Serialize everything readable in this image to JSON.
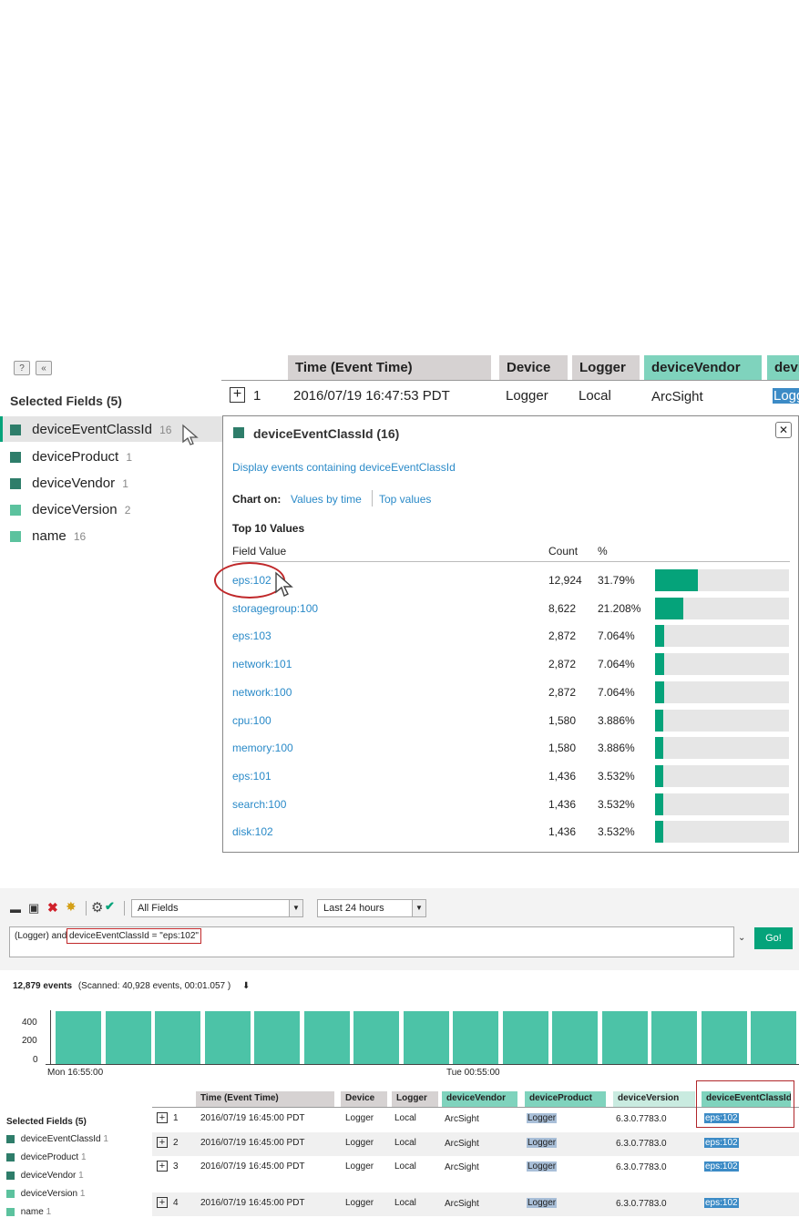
{
  "top": {
    "help_label": "?",
    "collapse_label": "«",
    "selected_fields_title": "Selected Fields (5)",
    "fields": [
      {
        "name": "deviceEventClassId",
        "count": "16",
        "color": "#2e7d6a"
      },
      {
        "name": "deviceProduct",
        "count": "1",
        "color": "#2e7d6a"
      },
      {
        "name": "deviceVendor",
        "count": "1",
        "color": "#2e7d6a"
      },
      {
        "name": "deviceVersion",
        "count": "2",
        "color": "#5cc29e"
      },
      {
        "name": "name",
        "count": "16",
        "color": "#5cc29e"
      }
    ],
    "columns": [
      "Time (Event Time)",
      "Device",
      "Logger",
      "deviceVendor",
      "devi"
    ],
    "row": {
      "index": "1",
      "time": "2016/07/19 16:47:53 PDT",
      "device": "Logger",
      "logger": "Local",
      "vendor": "ArcSight",
      "product": "Logg"
    },
    "popup": {
      "title": "deviceEventClassId (16)",
      "close_label": "✕",
      "display_link": "Display events containing deviceEventClassId",
      "chart_on_label": "Chart on:",
      "values_by_time": "Values by time",
      "top_values": "Top values",
      "top10_title": "Top 10 Values",
      "col_field_value": "Field Value",
      "col_count": "Count",
      "col_pct": "%",
      "rows": [
        {
          "value": "eps:102",
          "count": "12,924",
          "pct": "31.79%",
          "frac": 0.3179
        },
        {
          "value": "storagegroup:100",
          "count": "8,622",
          "pct": "21.208%",
          "frac": 0.21208
        },
        {
          "value": "eps:103",
          "count": "2,872",
          "pct": "7.064%",
          "frac": 0.07064
        },
        {
          "value": "network:101",
          "count": "2,872",
          "pct": "7.064%",
          "frac": 0.07064
        },
        {
          "value": "network:100",
          "count": "2,872",
          "pct": "7.064%",
          "frac": 0.07064
        },
        {
          "value": "cpu:100",
          "count": "1,580",
          "pct": "3.886%",
          "frac": 0.03886
        },
        {
          "value": "memory:100",
          "count": "1,580",
          "pct": "3.886%",
          "frac": 0.03886
        },
        {
          "value": "eps:101",
          "count": "1,436",
          "pct": "3.532%",
          "frac": 0.03532
        },
        {
          "value": "search:100",
          "count": "1,436",
          "pct": "3.532%",
          "frac": 0.03532
        },
        {
          "value": "disk:102",
          "count": "1,436",
          "pct": "3.532%",
          "frac": 0.03532
        }
      ]
    }
  },
  "bottom": {
    "toolbar": {
      "field_select": "All Fields",
      "time_select": "Last 24 hours",
      "query_prefix": "(Logger) and ",
      "query_highlight": "deviceEventClassId = \"eps:102\"",
      "go_label": "Go!"
    },
    "summary": {
      "events": "12,879 events",
      "scanned": "(Scanned: 40,928 events,  00:01.057 )"
    },
    "histogram": {
      "y_ticks": [
        "400",
        "200",
        "0"
      ],
      "x_labels": [
        "Mon 16:55:00",
        "Tue 00:55:00"
      ],
      "bar_frac": [
        0.97,
        0.97,
        0.97,
        0.97,
        0.97,
        0.97,
        0.97,
        0.97,
        0.97,
        0.97,
        0.97,
        0.97,
        0.97,
        0.97,
        0.97
      ]
    },
    "selected_fields_title": "Selected Fields (5)",
    "fields": [
      {
        "name": "deviceEventClassId",
        "count": "1",
        "color": "#2e7d6a"
      },
      {
        "name": "deviceProduct",
        "count": "1",
        "color": "#2e7d6a"
      },
      {
        "name": "deviceVendor",
        "count": "1",
        "color": "#2e7d6a"
      },
      {
        "name": "deviceVersion",
        "count": "1",
        "color": "#5cc29e"
      },
      {
        "name": "name",
        "count": "1",
        "color": "#5cc29e"
      }
    ],
    "columns": [
      "Time (Event Time)",
      "Device",
      "Logger",
      "deviceVendor",
      "deviceProduct",
      "deviceVersion",
      "deviceEventClassId"
    ],
    "rows": [
      {
        "index": "1",
        "time": "2016/07/19 16:45:00 PDT",
        "device": "Logger",
        "logger": "Local",
        "vendor": "ArcSight",
        "product": "Logger",
        "version": "6.3.0.7783.0",
        "classid": "eps:102"
      },
      {
        "index": "2",
        "time": "2016/07/19 16:45:00 PDT",
        "device": "Logger",
        "logger": "Local",
        "vendor": "ArcSight",
        "product": "Logger",
        "version": "6.3.0.7783.0",
        "classid": "eps:102"
      },
      {
        "index": "3",
        "time": "2016/07/19 16:45:00 PDT",
        "device": "Logger",
        "logger": "Local",
        "vendor": "ArcSight",
        "product": "Logger",
        "version": "6.3.0.7783.0",
        "classid": "eps:102"
      },
      {
        "index": "4",
        "time": "2016/07/19 16:45:00 PDT",
        "device": "Logger",
        "logger": "Local",
        "vendor": "ArcSight",
        "product": "Logger",
        "version": "6.3.0.7783.0",
        "classid": "eps:102"
      }
    ]
  }
}
